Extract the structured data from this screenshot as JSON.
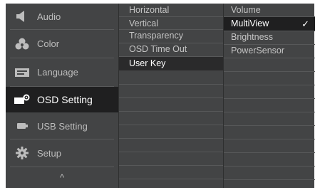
{
  "menu": {
    "items": [
      {
        "label": "Audio",
        "icon": "speaker-icon"
      },
      {
        "label": "Color",
        "icon": "color-palette-icon"
      },
      {
        "label": "Language",
        "icon": "language-txt-icon"
      },
      {
        "label": "OSD Setting",
        "icon": "osd-setting-icon"
      },
      {
        "label": "USB Setting",
        "icon": "usb-icon"
      },
      {
        "label": "Setup",
        "icon": "gear-icon"
      }
    ],
    "up_arrow": "^",
    "active_item": "OSD Setting"
  },
  "osd_submenu": {
    "items": [
      "Horizontal",
      "Vertical",
      "Transparency",
      "OSD Time Out",
      "User Key"
    ],
    "active_item": "User Key"
  },
  "userkey_options": {
    "items": [
      "Volume",
      "MultiView",
      "Brightness",
      "PowerSensor"
    ],
    "selected_item": "MultiView",
    "check_mark": "✓"
  },
  "colors": {
    "panel_bg": "#434445",
    "active_bg": "#1f1f20",
    "text": "#c4c4c4",
    "text_active": "#ffffff"
  }
}
